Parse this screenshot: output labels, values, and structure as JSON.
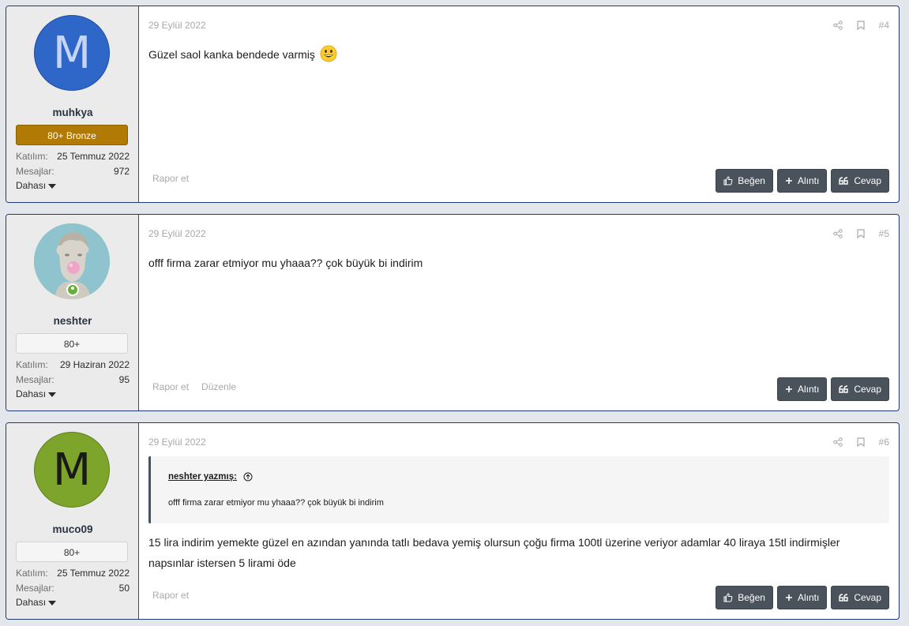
{
  "posts": [
    {
      "username": "muhkya",
      "avatar_letter": "M",
      "badge": "80+ Bronze",
      "joined_label": "Katılım:",
      "joined": "25 Temmuz 2022",
      "messages_label": "Mesajlar:",
      "messages": "972",
      "more_label": "Dahası",
      "date": "29 Eylül 2022",
      "number": "#4",
      "message": "Güzel saol kanka bendede varmiş",
      "links": [
        "Rapor et"
      ],
      "buttons": [
        "Beğen",
        "Alıntı",
        "Cevap"
      ]
    },
    {
      "username": "neshter",
      "badge": "80+",
      "joined_label": "Katılım:",
      "joined": "29 Haziran 2022",
      "messages_label": "Mesajlar:",
      "messages": "95",
      "more_label": "Dahası",
      "date": "29 Eylül 2022",
      "number": "#5",
      "message": "offf firma zarar etmiyor mu yhaaa?? çok büyük bi indirim",
      "links": [
        "Rapor et",
        "Düzenle"
      ],
      "buttons": [
        "Alıntı",
        "Cevap"
      ]
    },
    {
      "username": "muco09",
      "avatar_letter": "M",
      "badge": "80+",
      "joined_label": "Katılım:",
      "joined": "25 Temmuz 2022",
      "messages_label": "Mesajlar:",
      "messages": "50",
      "more_label": "Dahası",
      "date": "29 Eylül 2022",
      "number": "#6",
      "quote_author": "neshter yazmış:",
      "quote_text": "offf firma zarar etmiyor mu yhaaa?? çok büyük bi indirim",
      "message": "15 lira indirim yemekte güzel en azından yanında tatlı bedava yemiş olursun çoğu firma 100tl üzerine veriyor adamlar 40 liraya 15tl indirmişler napsınlar istersen 5 lirami öde",
      "links": [
        "Rapor et"
      ],
      "buttons": [
        "Beğen",
        "Alıntı",
        "Cevap"
      ]
    }
  ],
  "colors": {
    "bronze": "#b07a04",
    "button": "#4a535c",
    "avatar_blue": "#2f67c9",
    "avatar_green": "#7ea52b",
    "online": "#63b03a"
  }
}
